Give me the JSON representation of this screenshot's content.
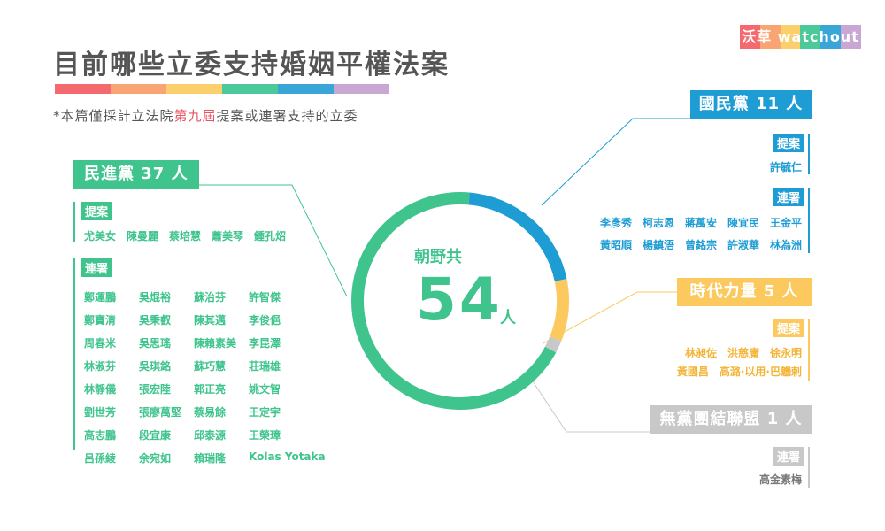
{
  "title": "目前哪些立委支持婚姻平權法案",
  "note": {
    "prefix": "*本篇僅採計立法院",
    "highlight": "第九屆",
    "suffix": "提案或連署支持的立委"
  },
  "logo": {
    "text": "沃草 watchout"
  },
  "colors": {
    "green": "#3fc48d",
    "blue": "#1e9cd4",
    "yellow": "#fbc95e",
    "grey": "#c8c8c8",
    "bar": [
      "#f56a6f",
      "#f9a472",
      "#fbcf6c",
      "#4cc99b",
      "#3aa6d8",
      "#c9a7d3"
    ]
  },
  "center": {
    "label": "朝野共",
    "total": "54",
    "unit": "人"
  },
  "chart_data": {
    "type": "pie",
    "total": 54,
    "slices": [
      {
        "label": "民進黨",
        "value": 37,
        "color": "#3fc48d"
      },
      {
        "label": "國民黨",
        "value": 11,
        "color": "#1e9cd4"
      },
      {
        "label": "時代力量",
        "value": 5,
        "color": "#fbc95e"
      },
      {
        "label": "無黨團結聯盟",
        "value": 1,
        "color": "#c8c8c8"
      }
    ]
  },
  "dpp": {
    "header": "民進黨 37 人",
    "proposal_label": "提案",
    "proposal_names": "尤美女　陳曼麗　蔡培慧　蕭美琴　鍾孔炤",
    "cosign_label": "連署",
    "cosign_names": [
      "鄭運鵬",
      "吳焜裕",
      "蘇治芬",
      "許智傑",
      "鄭寶清",
      "吳秉叡",
      "陳其邁",
      "李俊俋",
      "周春米",
      "吳思瑤",
      "陳賴素美",
      "李昆澤",
      "林淑芬",
      "吳琪銘",
      "蘇巧慧",
      "莊瑞雄",
      "林靜儀",
      "張宏陸",
      "郭正亮",
      "姚文智",
      "劉世芳",
      "張廖萬堅",
      "蔡易餘",
      "王定宇",
      "高志鵬",
      "段宜康",
      "邱泰源",
      "王榮璋",
      "呂孫綾",
      "余宛如",
      "賴瑞隆",
      "Kolas Yotaka"
    ]
  },
  "kmt": {
    "header": "國民黨 11 人",
    "proposal_label": "提案",
    "proposal_names": "許毓仁",
    "cosign_label": "連署",
    "cosign_line1": "李彥秀　柯志恩　蔣萬安　陳宜民　王金平",
    "cosign_line2": "黃昭順　楊鎮浯　曾銘宗　許淑華　林為洲"
  },
  "npp": {
    "header": "時代力量 5 人",
    "proposal_label": "提案",
    "line1": "林昶佐　洪慈庸　徐永明",
    "line2": "黃國昌　高潞·以用·巴魕剌"
  },
  "nsu": {
    "header": "無黨團結聯盟 1 人",
    "cosign_label": "連署",
    "names": "高金素梅"
  }
}
